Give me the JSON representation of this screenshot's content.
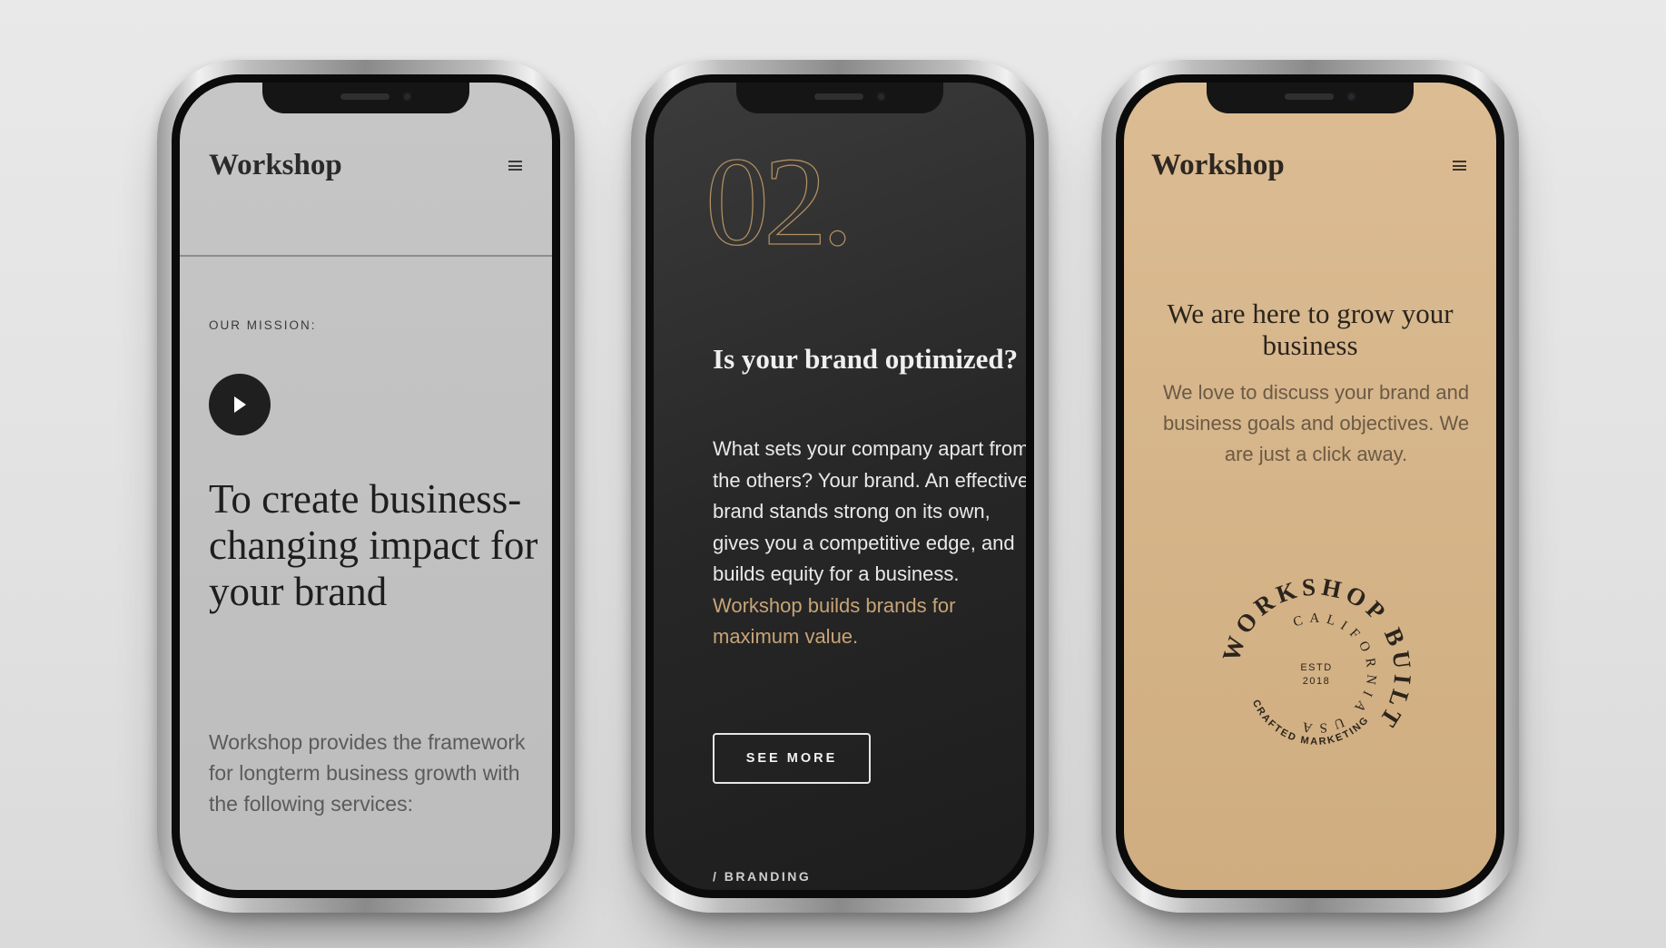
{
  "phone1": {
    "brand": "Workshop",
    "menu_icon": "hamburger-menu-icon",
    "mission_label": "OUR MISSION:",
    "play_icon": "play-icon",
    "headline": "To create business-changing impact for your brand",
    "body": "Workshop provides the framework for longterm business growth with the following services:",
    "colors": {
      "screen": "#c2c2c2",
      "text": "#1e1e1e"
    }
  },
  "phone2": {
    "number": "02.",
    "heading": "Is your brand optimized?",
    "body": "What sets your company apart from the others? Your brand. An effective brand stands strong on its own, gives you a competitive edge, and builds equity for a business.",
    "body_highlight": "Workshop builds brands for maximum value.",
    "button_label": "SEE MORE",
    "tag": "/ BRANDING",
    "colors": {
      "screen": "#272727",
      "accent": "#c7a477"
    }
  },
  "phone3": {
    "brand": "Workshop",
    "menu_icon": "hamburger-menu-icon",
    "heading": "We are here to grow your business",
    "body": "We love to discuss your brand and business goals and objectives. We are just a click away.",
    "emblem": {
      "outer_text": "WORKSHOP BUILT",
      "inner_text": "CALIFORNIA USA",
      "bottom_text": "CRAFTED MARKETING",
      "center_top": "ESTD",
      "center_bottom": "2018"
    },
    "colors": {
      "screen": "#d6b68a",
      "text": "#2a241d"
    }
  }
}
